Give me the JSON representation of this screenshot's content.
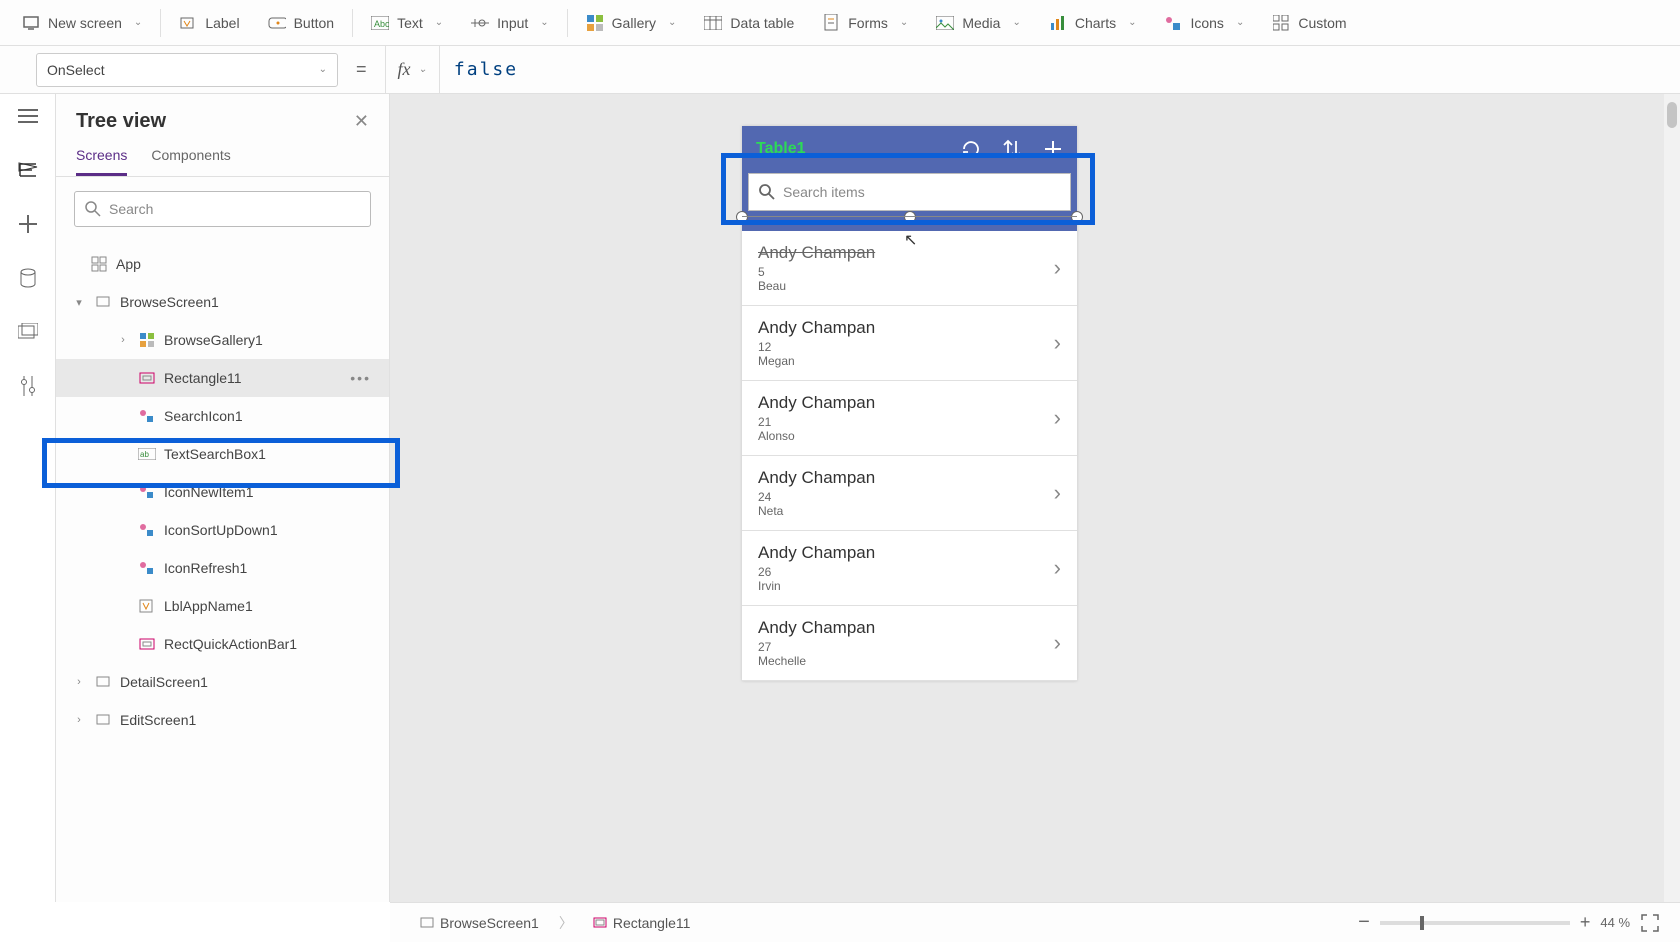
{
  "toolbar": {
    "new_screen": "New screen",
    "label": "Label",
    "button": "Button",
    "text": "Text",
    "input": "Input",
    "gallery": "Gallery",
    "data_table": "Data table",
    "forms": "Forms",
    "media": "Media",
    "charts": "Charts",
    "icons": "Icons",
    "custom": "Custom"
  },
  "formula": {
    "prop": "OnSelect",
    "value": "false"
  },
  "tree": {
    "title": "Tree view",
    "tabs": {
      "screens": "Screens",
      "components": "Components"
    },
    "search_placeholder": "Search",
    "app": "App",
    "items": [
      {
        "label": "BrowseScreen1",
        "indent": 1,
        "arrow": "▾",
        "icon": "screen"
      },
      {
        "label": "BrowseGallery1",
        "indent": 2,
        "arrow": "›",
        "icon": "gallery"
      },
      {
        "label": "Rectangle11",
        "indent": 2,
        "arrow": "",
        "icon": "rect",
        "selected": true
      },
      {
        "label": "SearchIcon1",
        "indent": 2,
        "arrow": "",
        "icon": "ico"
      },
      {
        "label": "TextSearchBox1",
        "indent": 2,
        "arrow": "",
        "icon": "txt"
      },
      {
        "label": "IconNewItem1",
        "indent": 2,
        "arrow": "",
        "icon": "ico"
      },
      {
        "label": "IconSortUpDown1",
        "indent": 2,
        "arrow": "",
        "icon": "ico"
      },
      {
        "label": "IconRefresh1",
        "indent": 2,
        "arrow": "",
        "icon": "ico"
      },
      {
        "label": "LblAppName1",
        "indent": 2,
        "arrow": "",
        "icon": "label"
      },
      {
        "label": "RectQuickActionBar1",
        "indent": 2,
        "arrow": "",
        "icon": "rect"
      },
      {
        "label": "DetailScreen1",
        "indent": 1,
        "arrow": "›",
        "icon": "screen"
      },
      {
        "label": "EditScreen1",
        "indent": 1,
        "arrow": "›",
        "icon": "screen"
      }
    ]
  },
  "phone": {
    "title": "Table1",
    "search_placeholder": "Search items",
    "gallery": [
      {
        "title": "Andy Champan",
        "sub1": "5",
        "sub2": "Beau"
      },
      {
        "title": "Andy Champan",
        "sub1": "12",
        "sub2": "Megan"
      },
      {
        "title": "Andy Champan",
        "sub1": "21",
        "sub2": "Alonso"
      },
      {
        "title": "Andy Champan",
        "sub1": "24",
        "sub2": "Neta"
      },
      {
        "title": "Andy Champan",
        "sub1": "26",
        "sub2": "Irvin"
      },
      {
        "title": "Andy Champan",
        "sub1": "27",
        "sub2": "Mechelle"
      }
    ]
  },
  "breadcrumb": {
    "a": "BrowseScreen1",
    "b": "Rectangle11"
  },
  "zoom": {
    "value": "44",
    "pct": "%"
  }
}
